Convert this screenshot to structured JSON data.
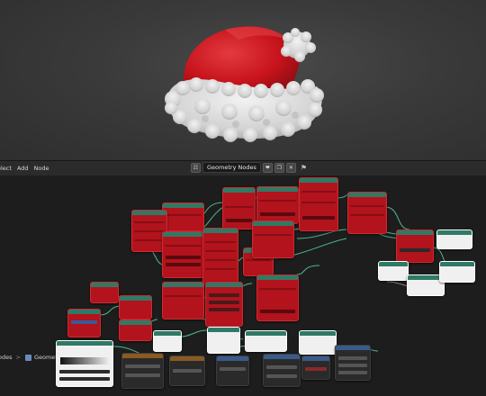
{
  "menubar": {
    "items": [
      "elect",
      "Add",
      "Node"
    ],
    "tree_name": "Geometry Nodes",
    "fake_user_glyph": "❤",
    "pin_glyph": "⚑"
  },
  "breadcrumb": {
    "root": "odes",
    "separator": ">",
    "current": "Geometry Nodes"
  },
  "colors": {
    "hat_red": "#c8141c",
    "fur_white": "#e4e4e4",
    "node_red": "#b3131c",
    "node_header_teal": "#2f7a66",
    "wire_green": "#4fb88e"
  },
  "icons": {
    "editor_type": "node-tree-icon",
    "geometry_nodes": "geometry-nodes-icon"
  }
}
